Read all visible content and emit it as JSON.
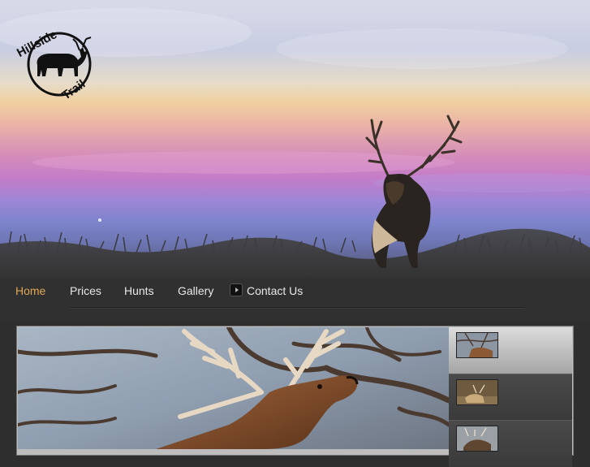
{
  "site": {
    "logo_text": "Hillside Trail"
  },
  "nav": {
    "items": [
      {
        "label": "Home",
        "active": true
      },
      {
        "label": "Prices",
        "active": false
      },
      {
        "label": "Hunts",
        "active": false
      },
      {
        "label": "Gallery",
        "active": false
      },
      {
        "label": "Contact Us",
        "active": false
      }
    ]
  },
  "colors": {
    "active_nav": "#e0a856",
    "nav_text": "#e8e8e8",
    "background": "#2e2e2e"
  },
  "slider": {
    "thumbnails": [
      {
        "state": "selected"
      },
      {
        "state": "normal"
      },
      {
        "state": "normal"
      }
    ]
  }
}
